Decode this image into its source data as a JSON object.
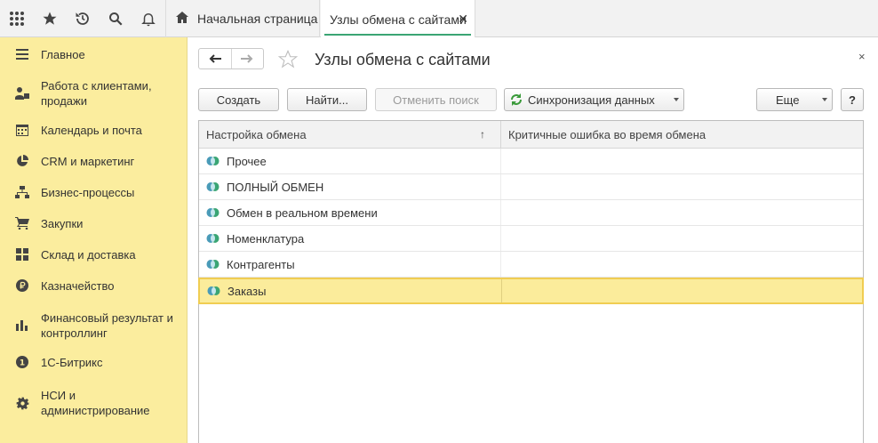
{
  "topbar": {
    "icons": [
      "apps-grid-icon",
      "star-icon",
      "history-icon",
      "search-icon",
      "bell-icon"
    ],
    "tabs": [
      {
        "label": "Начальная страница",
        "icon": "home-icon"
      },
      {
        "label": "Узлы обмена с сайтами",
        "close": "✕"
      }
    ]
  },
  "sidebar": {
    "items": [
      {
        "label": "Главное",
        "icon": "menu-lines-icon"
      },
      {
        "label": "Работа с клиентами, продажи",
        "icon": "clients-icon"
      },
      {
        "label": "Календарь и почта",
        "icon": "calendar-icon"
      },
      {
        "label": "CRM и маркетинг",
        "icon": "pie-chart-icon"
      },
      {
        "label": "Бизнес-процессы",
        "icon": "hierarchy-icon"
      },
      {
        "label": "Закупки",
        "icon": "cart-icon"
      },
      {
        "label": "Склад и доставка",
        "icon": "warehouse-grid-icon"
      },
      {
        "label": "Казначейство",
        "icon": "ruble-coin-icon"
      },
      {
        "label": "Финансовый результат и контроллинг",
        "icon": "bar-chart-icon"
      },
      {
        "label": "1С-Битрикс",
        "icon": "bitrix-icon"
      },
      {
        "label": "НСИ и администрирование",
        "icon": "gear-icon"
      }
    ]
  },
  "form": {
    "title": "Узлы обмена с сайтами",
    "close": "×",
    "toolbar": {
      "create": "Создать",
      "find": "Найти...",
      "cancel_search": "Отменить поиск",
      "sync": "Синхронизация данных",
      "more": "Еще",
      "help": "?"
    },
    "table": {
      "columns": [
        "Настройка обмена",
        "Критичные ошибка во время обмена"
      ],
      "sort_indicator": "↑",
      "rows": [
        {
          "name": "Прочее",
          "errors": ""
        },
        {
          "name": "ПОЛНЫЙ ОБМЕН",
          "errors": ""
        },
        {
          "name": "Обмен в реальном времени",
          "errors": ""
        },
        {
          "name": "Номенклатура",
          "errors": ""
        },
        {
          "name": "Контрагенты",
          "errors": ""
        },
        {
          "name": "Заказы",
          "errors": "",
          "selected": true
        }
      ]
    }
  },
  "colors": {
    "sidebar_bg": "#fbed9e",
    "selection_bg": "#fbec9b",
    "selection_border": "#f0cd52",
    "tab_accent": "#3aa574"
  }
}
